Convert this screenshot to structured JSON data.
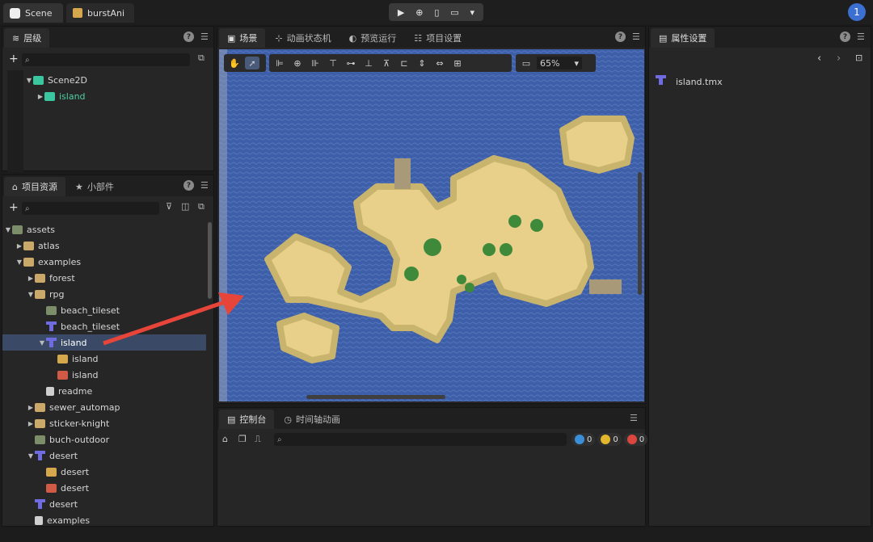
{
  "top": {
    "tabs": [
      {
        "label": "Scene"
      },
      {
        "label": "burstAni"
      }
    ],
    "avatar": "1"
  },
  "hierarchy": {
    "tab": "层级",
    "items": [
      {
        "label": "Scene2D"
      },
      {
        "label": "island"
      }
    ]
  },
  "assets": {
    "tabs": [
      {
        "label": "项目资源"
      },
      {
        "label": "小部件"
      }
    ],
    "items": [
      {
        "label": "assets"
      },
      {
        "label": "atlas"
      },
      {
        "label": "examples"
      },
      {
        "label": "forest"
      },
      {
        "label": "rpg"
      },
      {
        "label": "beach_tileset"
      },
      {
        "label": "beach_tileset"
      },
      {
        "label": "island"
      },
      {
        "label": "island"
      },
      {
        "label": "island"
      },
      {
        "label": "readme"
      },
      {
        "label": "sewer_automap"
      },
      {
        "label": "sticker-knight"
      },
      {
        "label": "buch-outdoor"
      },
      {
        "label": "desert"
      },
      {
        "label": "desert"
      },
      {
        "label": "desert"
      },
      {
        "label": "desert"
      },
      {
        "label": "examples"
      }
    ]
  },
  "editor": {
    "tabs": [
      {
        "label": "场景"
      },
      {
        "label": "动画状态机"
      },
      {
        "label": "预览运行"
      },
      {
        "label": "项目设置"
      }
    ],
    "zoom": "65%"
  },
  "console": {
    "tabs": [
      {
        "label": "控制台"
      },
      {
        "label": "时间轴动画"
      }
    ],
    "counts": {
      "info": "0",
      "warn": "0",
      "error": "0"
    }
  },
  "inspector": {
    "tab": "属性设置",
    "file": "island.tmx"
  },
  "colors": {
    "water": "#3d5ea8",
    "sand": "#e8d08a",
    "selection": "#3a4a66",
    "accent": "#3b6fd1"
  }
}
